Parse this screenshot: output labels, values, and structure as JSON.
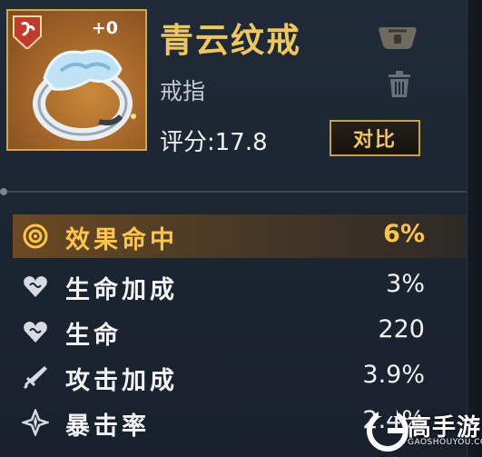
{
  "item": {
    "name": "青云纹戒",
    "type": "戒指",
    "enhance_level": "+0",
    "score_label": "评分:17.8",
    "compare_label": "对比"
  },
  "stats": [
    {
      "name": "效果命中",
      "value": "6%",
      "icon": "target-icon",
      "highlighted": true
    },
    {
      "name": "生命加成",
      "value": "3%",
      "icon": "heart-icon"
    },
    {
      "name": "生命",
      "value": "220",
      "icon": "heart-icon"
    },
    {
      "name": "攻击加成",
      "value": "3.9%",
      "icon": "sword-icon"
    },
    {
      "name": "暴击率",
      "value": "2.4%",
      "icon": "crit-icon"
    }
  ],
  "watermark": {
    "brand": "高手游",
    "url": "GAOSHOUYOU.COM"
  },
  "colors": {
    "gold": "#f0c75d",
    "highlight": "#ffc54a",
    "tile": "#a8682a",
    "badge": "#c23a2c"
  }
}
